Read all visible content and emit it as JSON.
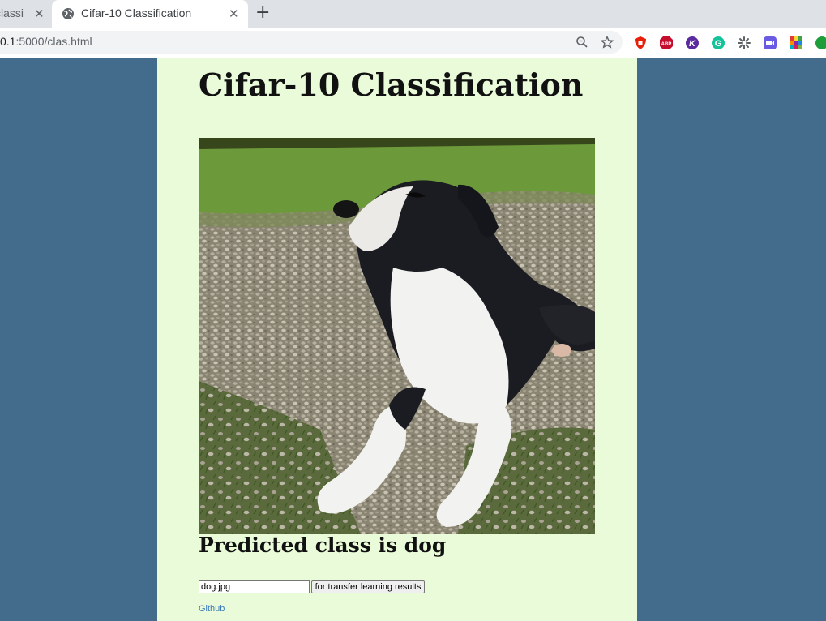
{
  "browser": {
    "tabs": [
      {
        "label": "classi",
        "active": false
      },
      {
        "label": "Cifar-10 Classification",
        "active": true
      }
    ],
    "close_glyph": "✕",
    "new_tab_glyph": "+",
    "url_host": "0.1",
    "url_path": ":5000/clas.html",
    "extensions": [
      {
        "name": "ublock-icon",
        "color": "#e8200b",
        "text": ""
      },
      {
        "name": "adblock-plus-icon",
        "color": "#c70d2c",
        "text": "ABP"
      },
      {
        "name": "k-extension-icon",
        "color": "#5b2a9f",
        "text": "K"
      },
      {
        "name": "grammarly-icon",
        "color": "#15c39a",
        "text": "G"
      },
      {
        "name": "spinner-extension-icon",
        "color": "#5f6368",
        "text": ""
      },
      {
        "name": "zoom-extension-icon",
        "color": "#6a5be2",
        "text": ""
      },
      {
        "name": "color-grid-extension-icon",
        "color": "#e53935",
        "text": ""
      },
      {
        "name": "green-extension-icon",
        "color": "#1e9e3a",
        "text": ""
      }
    ]
  },
  "page": {
    "title": "Cifar-10 Classification",
    "image_alt": "dog",
    "prediction": "Predicted class is dog",
    "file_value": "dog.jpg",
    "submit_label": "for transfer learning results",
    "github_link": "Github",
    "colors": {
      "background": "#436c8c",
      "content": "#eafbd9",
      "link": "#3a7ab8"
    }
  }
}
